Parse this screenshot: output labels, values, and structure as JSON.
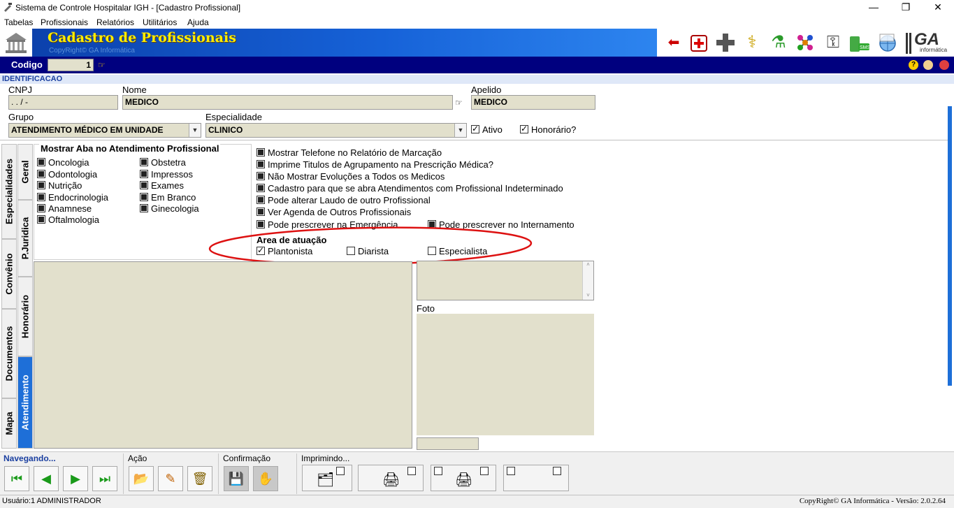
{
  "window": {
    "title": "Sistema de Controle Hospitalar IGH - [Cadastro Profissional]",
    "minimize": "—",
    "restore": "❐",
    "close": "✕"
  },
  "menu": [
    "Tabelas",
    "Profissionais",
    "Relatórios",
    "Utilitários",
    "Ajuda"
  ],
  "banner": {
    "title": "Cadastro de Profissionais",
    "subtitle": "CopyRight© GA Informática"
  },
  "toolbar_icons": [
    "back-help-icon",
    "medical-kit-icon",
    "cross-icon",
    "caduceus-icon",
    "lab-icon",
    "molecule-icon",
    "keys-icon",
    "sms-icon",
    "web-icon",
    "ga-logo-icon"
  ],
  "ga_logo": "GA",
  "ga_logo_sub": "informática",
  "codigo": {
    "label": "Codigo",
    "value": "1"
  },
  "section_title": "IDENTIFICACAO",
  "fields": {
    "cnpj_label": "CNPJ",
    "cnpj_value": " .  .   /    -",
    "nome_label": "Nome",
    "nome_value": "MEDICO",
    "apelido_label": "Apelido",
    "apelido_value": "MEDICO",
    "grupo_label": "Grupo",
    "grupo_value": "ATENDIMENTO MÉDICO EM UNIDADE",
    "especialidade_label": "Especialidade",
    "especialidade_value": "CLINICO",
    "ativo_label": "Ativo",
    "honorario_label": "Honorário?"
  },
  "vertical_tabs_outer": [
    "Especialidades",
    "Convênio",
    "Documentos",
    "Mapa"
  ],
  "vertical_tabs_inner": [
    "Geral",
    "P.Juridica",
    "Honorário",
    "Atendimento"
  ],
  "mostrar_aba": {
    "title": "Mostrar Aba no Atendimento Profissional",
    "col1": [
      "Oncologia",
      "Odontologia",
      "Nutrição",
      "Endocrinologia",
      "Anamnese",
      "Oftalmologia"
    ],
    "col2": [
      "Obstetra",
      "Impressos",
      "Exames",
      "Em Branco",
      "Ginecologia"
    ]
  },
  "options": [
    "Mostrar Telefone no Relatório de Marcação",
    "Imprime Titulos de Agrupamento na Prescrição Médica?",
    "Não Mostrar Evoluções a Todos os Medicos",
    "Cadastro para que se abra Atendimentos com Profissional Indeterminado",
    "Pode alterar Laudo de outro Profissional",
    "Ver Agenda de Outros Profissionais",
    "Pode prescrever na Emergência"
  ],
  "option_internamento": "Pode prescrever no Internamento",
  "area_atuacao": {
    "title": "Area de atuação",
    "plantonista": "Plantonista",
    "diarista": "Diarista",
    "especialista": "Especialista"
  },
  "foto_label": "Foto",
  "bottom": {
    "navegando": "Navegando...",
    "acao": "Ação",
    "confirmacao": "Confirmação",
    "imprimindo": "Imprimindo..."
  },
  "status": {
    "user": "Usuário:1 ADMINISTRADOR",
    "copyright": "CopyRight© GA Informática - Versão: 2.0.2.64"
  },
  "colors": {
    "banner_title": "#ffee00",
    "field_bg": "#e2e0cc",
    "code_bar": "#00007f",
    "annotation_ellipse": "#dd1111",
    "active_tab": "#1e6fd8"
  }
}
